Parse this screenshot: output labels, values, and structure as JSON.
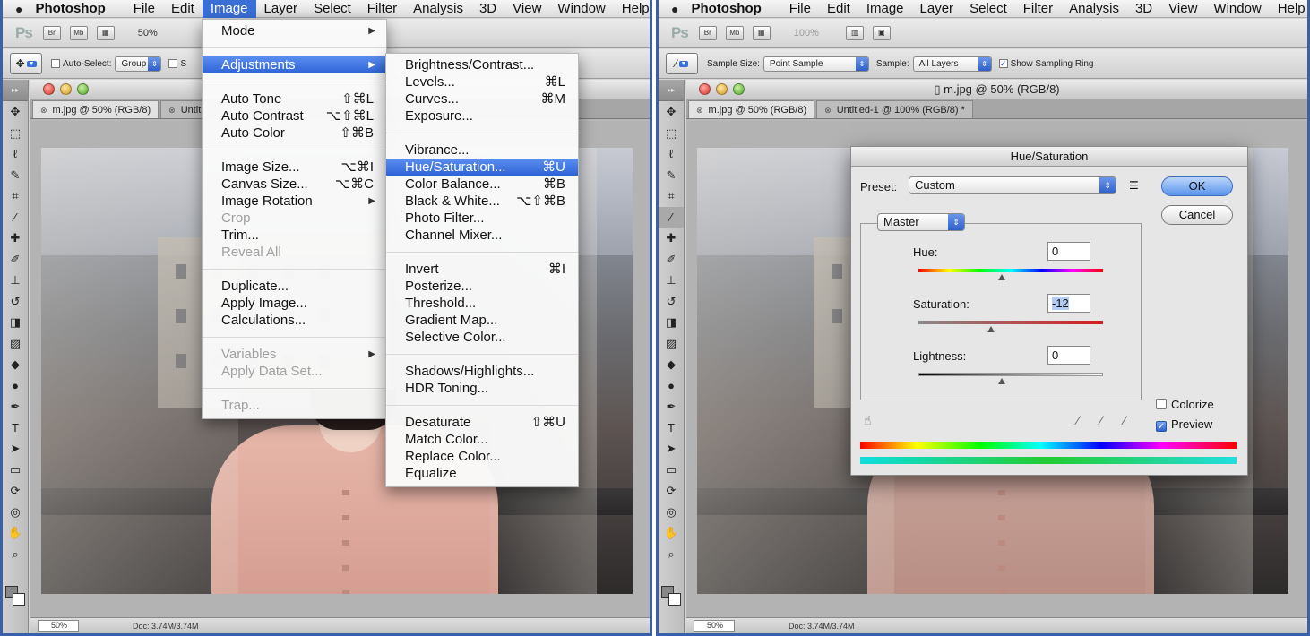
{
  "left": {
    "menubar": {
      "app": "Photoshop",
      "items": [
        "File",
        "Edit",
        "Image",
        "Layer",
        "Select",
        "Filter",
        "Analysis",
        "3D",
        "View",
        "Window",
        "Help"
      ],
      "active": "Image"
    },
    "appbar": {
      "zoom": "50%"
    },
    "options": {
      "auto_select": "Auto-Select:",
      "group_value": "Group",
      "cut_label": "S"
    },
    "tabs": [
      "m.jpg @ 50% (RGB/8)",
      "Untit"
    ],
    "status": {
      "zoom": "50%",
      "doc": "Doc: 3.74M/3.74M"
    },
    "image_menu": [
      {
        "label": "Mode",
        "submenu": true
      },
      {
        "sep": true
      },
      {
        "label": "Adjustments",
        "submenu": true,
        "highlight": true
      },
      {
        "sep": true
      },
      {
        "label": "Auto Tone",
        "shortcut": "⇧⌘L"
      },
      {
        "label": "Auto Contrast",
        "shortcut": "⌥⇧⌘L"
      },
      {
        "label": "Auto Color",
        "shortcut": "⇧⌘B"
      },
      {
        "sep": true
      },
      {
        "label": "Image Size...",
        "shortcut": "⌥⌘I"
      },
      {
        "label": "Canvas Size...",
        "shortcut": "⌥⌘C"
      },
      {
        "label": "Image Rotation",
        "submenu": true
      },
      {
        "label": "Crop",
        "disabled": true
      },
      {
        "label": "Trim..."
      },
      {
        "label": "Reveal All",
        "disabled": true
      },
      {
        "sep": true
      },
      {
        "label": "Duplicate..."
      },
      {
        "label": "Apply Image..."
      },
      {
        "label": "Calculations..."
      },
      {
        "sep": true
      },
      {
        "label": "Variables",
        "submenu": true,
        "disabled": true
      },
      {
        "label": "Apply Data Set...",
        "disabled": true
      },
      {
        "sep": true
      },
      {
        "label": "Trap...",
        "disabled": true
      }
    ],
    "adjustments_menu": [
      {
        "label": "Brightness/Contrast..."
      },
      {
        "label": "Levels...",
        "shortcut": "⌘L"
      },
      {
        "label": "Curves...",
        "shortcut": "⌘M"
      },
      {
        "label": "Exposure..."
      },
      {
        "sep": true
      },
      {
        "label": "Vibrance..."
      },
      {
        "label": "Hue/Saturation...",
        "shortcut": "⌘U",
        "highlight": true
      },
      {
        "label": "Color Balance...",
        "shortcut": "⌘B"
      },
      {
        "label": "Black & White...",
        "shortcut": "⌥⇧⌘B"
      },
      {
        "label": "Photo Filter..."
      },
      {
        "label": "Channel Mixer..."
      },
      {
        "sep": true
      },
      {
        "label": "Invert",
        "shortcut": "⌘I"
      },
      {
        "label": "Posterize..."
      },
      {
        "label": "Threshold..."
      },
      {
        "label": "Gradient Map..."
      },
      {
        "label": "Selective Color..."
      },
      {
        "sep": true
      },
      {
        "label": "Shadows/Highlights..."
      },
      {
        "label": "HDR Toning..."
      },
      {
        "sep": true
      },
      {
        "label": "Desaturate",
        "shortcut": "⇧⌘U"
      },
      {
        "label": "Match Color..."
      },
      {
        "label": "Replace Color..."
      },
      {
        "label": "Equalize"
      }
    ]
  },
  "right": {
    "menubar": {
      "app": "Photoshop",
      "items": [
        "File",
        "Edit",
        "Image",
        "Layer",
        "Select",
        "Filter",
        "Analysis",
        "3D",
        "View",
        "Window",
        "Help"
      ]
    },
    "appbar": {
      "zoom": "100%"
    },
    "options": {
      "sample_size_label": "Sample Size:",
      "sample_size_value": "Point Sample",
      "sample_label": "Sample:",
      "sample_value": "All Layers",
      "sampling_ring": "Show Sampling Ring"
    },
    "window_title": "m.jpg @ 50% (RGB/8)",
    "tabs": [
      "m.jpg @ 50% (RGB/8)",
      "Untitled-1 @ 100% (RGB/8) *"
    ],
    "status": {
      "zoom": "50%",
      "doc": "Doc: 3.74M/3.74M"
    },
    "dialog": {
      "title": "Hue/Saturation",
      "preset_label": "Preset:",
      "preset_value": "Custom",
      "ok": "OK",
      "cancel": "Cancel",
      "channel": "Master",
      "hue_label": "Hue:",
      "hue": "0",
      "saturation_label": "Saturation:",
      "saturation": "-12",
      "lightness_label": "Lightness:",
      "lightness": "0",
      "colorize": "Colorize",
      "colorize_checked": false,
      "preview": "Preview",
      "preview_checked": true
    }
  },
  "colors": {
    "frame": "#3a60a8",
    "highlight": "#2e63d6",
    "menu_bg": "#fafafa"
  }
}
